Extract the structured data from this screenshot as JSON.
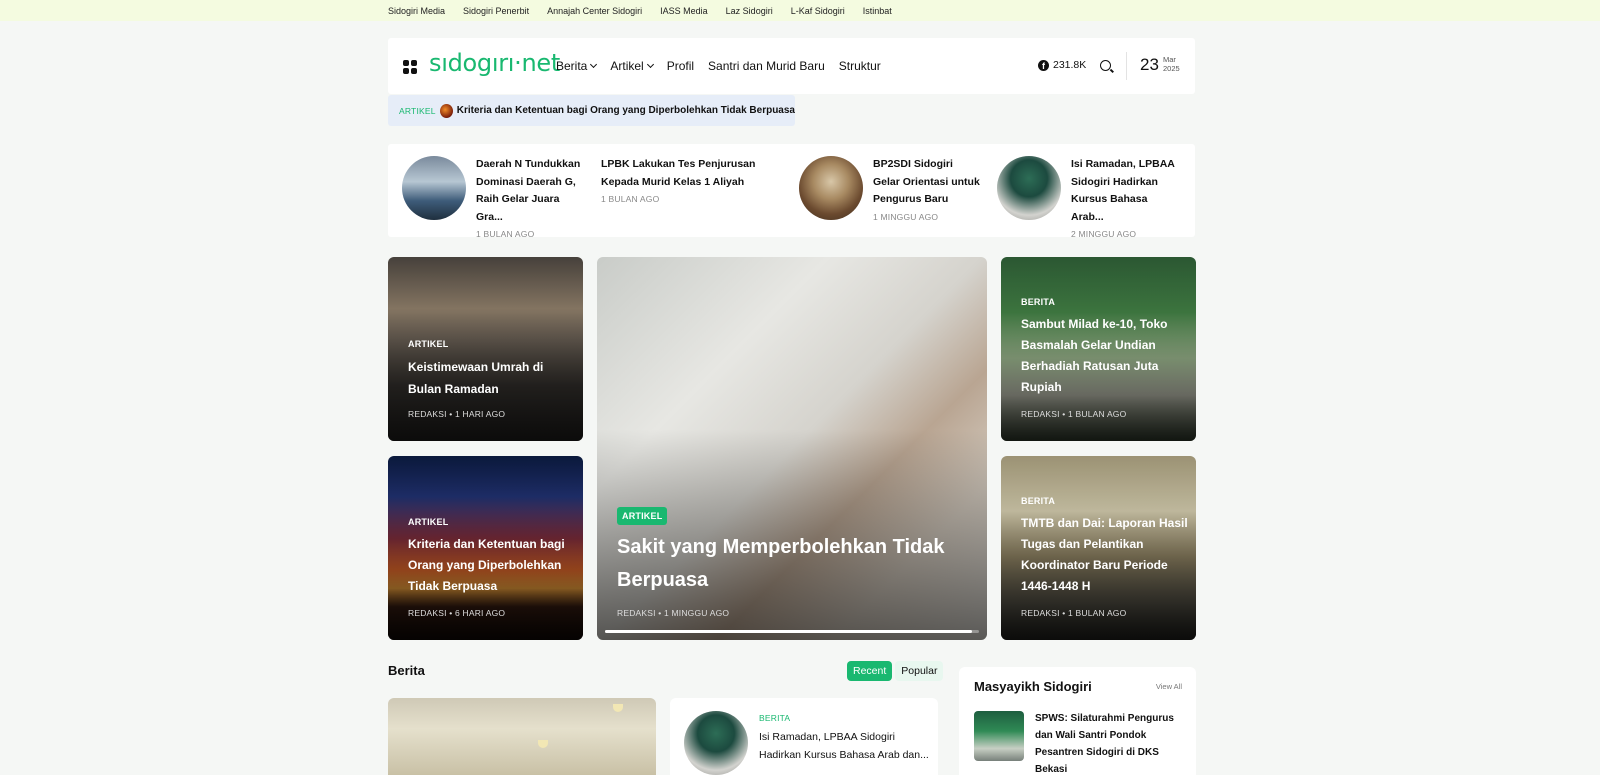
{
  "topbar": {
    "links": [
      "Sidogiri Media",
      "Sidogiri Penerbit",
      "Annajah Center Sidogiri",
      "IASS Media",
      "Laz Sidogiri",
      "L-Kaf Sidogiri",
      "Istinbat"
    ]
  },
  "header": {
    "logo": "sıdogırı·net",
    "nav": [
      {
        "label": "Berita",
        "dropdown": true
      },
      {
        "label": "Artikel",
        "dropdown": true
      },
      {
        "label": "Profil",
        "dropdown": false
      },
      {
        "label": "Santri dan Murid Baru",
        "dropdown": false
      },
      {
        "label": "Struktur",
        "dropdown": false
      }
    ],
    "facebook_count": "231.8K",
    "date": {
      "day": "23",
      "month": "Mar",
      "year": "2025"
    }
  },
  "ticker": {
    "label": "ARTIKEL",
    "title": "Kriteria dan Ketentuan bagi Orang yang Diperbolehkan Tidak Berpuasa"
  },
  "mini_posts": [
    {
      "title": "Daerah N Tundukkan Dominasi Daerah G, Raih Gelar Juara Gra...",
      "time": "1 BULAN AGO",
      "has_thumb": true
    },
    {
      "title": "LPBK Lakukan Tes Penjurusan Kepada Murid Kelas 1 Aliyah",
      "time": "1 BULAN AGO",
      "has_thumb": false
    },
    {
      "title": "BP2SDI Sidogiri Gelar Orientasi untuk Pengurus Baru",
      "time": "1 MINGGU AGO",
      "has_thumb": true
    },
    {
      "title": "Isi Ramadan, LPBAA Sidogiri Hadirkan Kursus Bahasa Arab...",
      "time": "2 MINGGU AGO",
      "has_thumb": true
    }
  ],
  "featured": {
    "left_top": {
      "category": "ARTIKEL",
      "title": "Keistimewaan Umrah di Bulan Ramadan",
      "meta": "REDAKSI • 1 HARI AGO"
    },
    "left_bottom": {
      "category": "ARTIKEL",
      "title": "Kriteria dan Ketentuan bagi Orang yang Diperbolehkan Tidak Berpuasa",
      "meta": "REDAKSI • 6 HARI AGO"
    },
    "center": {
      "category": "ARTIKEL",
      "title": "Sakit yang Memperbolehkan Tidak Berpuasa",
      "meta": "REDAKSI • 1 MINGGU AGO",
      "progress": 0.98
    },
    "right_top": {
      "category": "BERITA",
      "title": "Sambut Milad ke-10, Toko Basmalah Gelar Undian Berhadiah Ratusan Juta Rupiah",
      "meta": "REDAKSI • 1 BULAN AGO"
    },
    "right_bottom": {
      "category": "BERITA",
      "title": "TMTB dan Dai: Laporan Hasil Tugas dan Pelantikan Koordinator Baru Periode 1446-1448 H",
      "meta": "REDAKSI • 1 BULAN AGO"
    }
  },
  "berita": {
    "title": "Berita",
    "tabs": [
      "Recent",
      "Popular"
    ],
    "list_item": {
      "category": "BERITA",
      "title": "Isi Ramadan, LPBAA Sidogiri Hadirkan Kursus Bahasa Arab dan..."
    }
  },
  "sidebar": {
    "title": "Masyayikh Sidogiri",
    "view_all": "View All",
    "item": "SPWS: Silaturahmi Pengurus dan Wali Santri Pondok Pesantren Sidogiri di DKS Bekasi"
  },
  "colors": {
    "accent": "#19b870",
    "topbar": "#f4fbe0",
    "page_bg": "#f5f7f5"
  },
  "icons": [
    "grid-menu-icon",
    "chevron-down-icon",
    "facebook-icon",
    "search-icon"
  ]
}
